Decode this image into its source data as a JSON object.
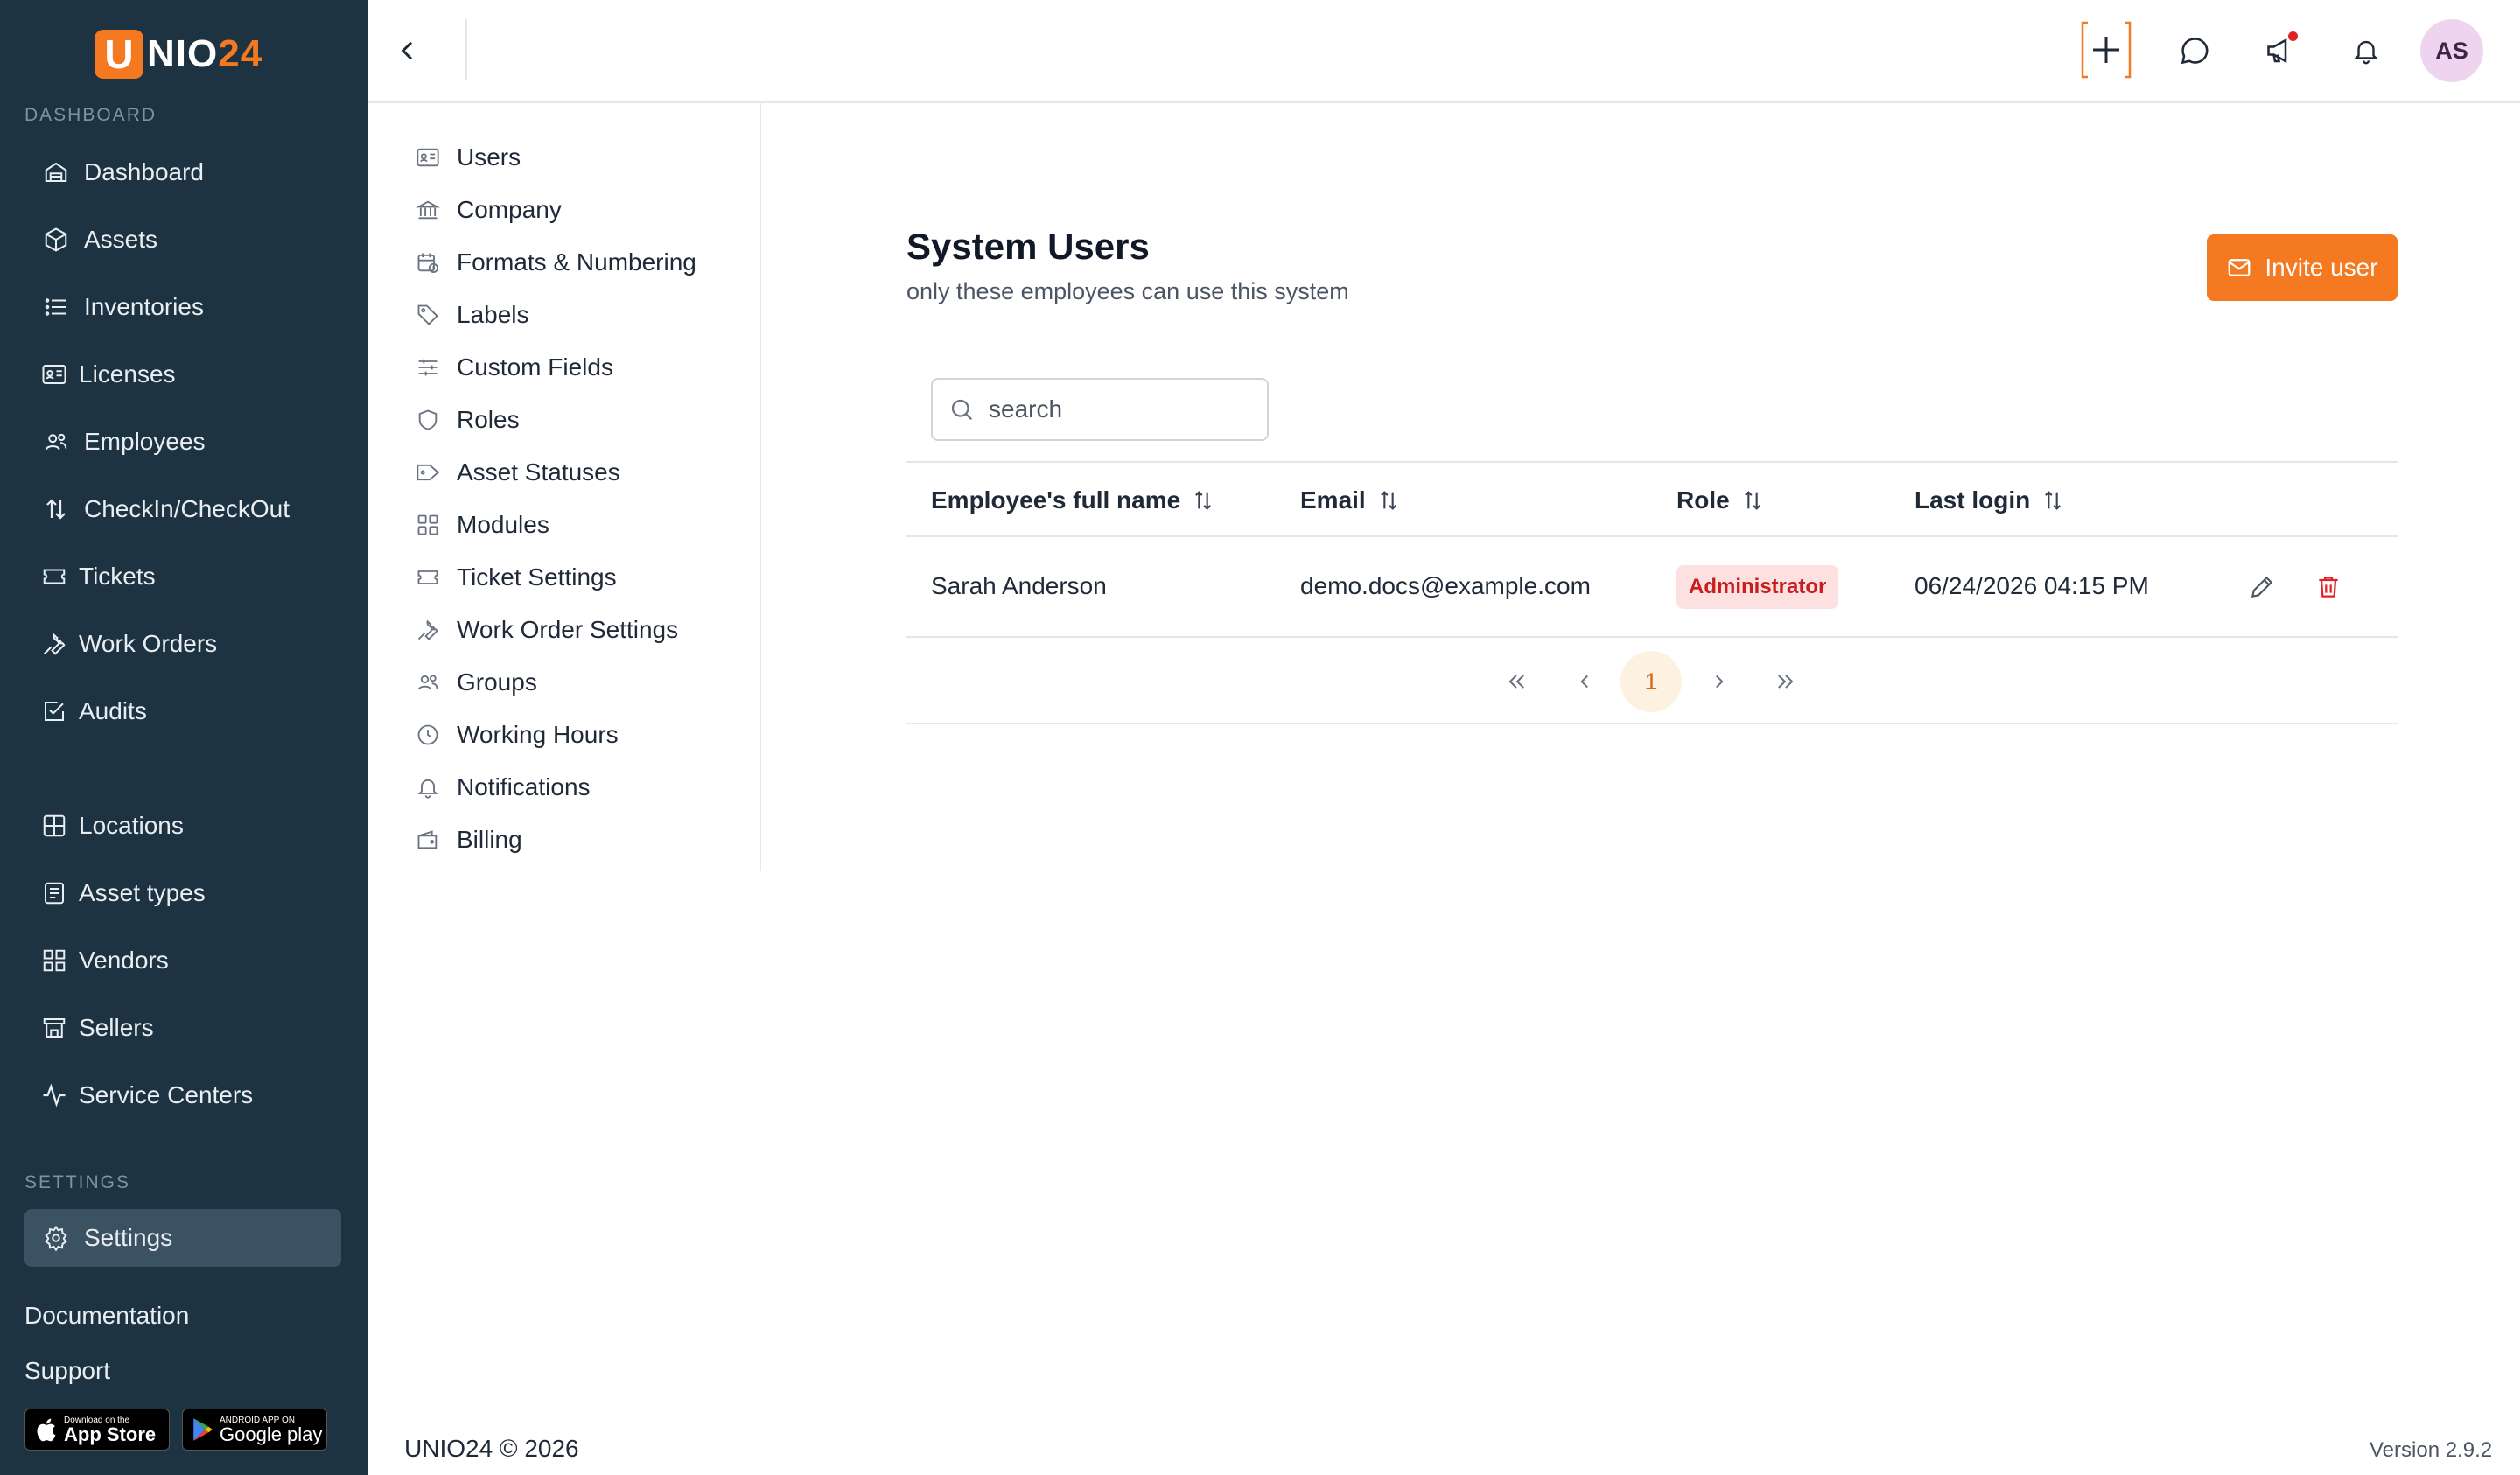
{
  "app": {
    "logo_letter": "U",
    "logo_rest": "NIO",
    "logo_num": "24"
  },
  "sidebar": {
    "dashboard_label": "DASHBOARD",
    "items": [
      {
        "label": "Dashboard",
        "icon": "dashboard-icon"
      },
      {
        "label": "Assets",
        "icon": "box-icon"
      },
      {
        "label": "Inventories",
        "icon": "list-icon"
      },
      {
        "label": "Licenses",
        "icon": "id-card-icon"
      },
      {
        "label": "Employees",
        "icon": "users-icon"
      },
      {
        "label": "CheckIn/CheckOut",
        "icon": "arrows-up-down-icon"
      },
      {
        "label": "Tickets",
        "icon": "ticket-icon"
      },
      {
        "label": "Work Orders",
        "icon": "wrench-icon"
      },
      {
        "label": "Audits",
        "icon": "checkbox-icon"
      },
      {
        "label": "Locations",
        "icon": "grid-icon"
      },
      {
        "label": "Asset types",
        "icon": "document-icon"
      },
      {
        "label": "Vendors",
        "icon": "apps-icon"
      },
      {
        "label": "Sellers",
        "icon": "store-icon"
      },
      {
        "label": "Service Centers",
        "icon": "activity-icon"
      }
    ],
    "settings_label": "SETTINGS",
    "settings_item": {
      "label": "Settings",
      "icon": "gear-icon"
    },
    "documentation": "Documentation",
    "support": "Support",
    "app_store": {
      "sub": "Download on the",
      "main": "App Store"
    },
    "google_play": {
      "sub": "ANDROID APP ON",
      "main": "Google play"
    }
  },
  "topbar": {
    "avatar_initials": "AS",
    "accent": "#f47920"
  },
  "settings_menu": [
    {
      "label": "Users",
      "icon": "user-card-icon"
    },
    {
      "label": "Company",
      "icon": "bank-icon"
    },
    {
      "label": "Formats & Numbering",
      "icon": "calendar-clock-icon"
    },
    {
      "label": "Labels",
      "icon": "tag-icon"
    },
    {
      "label": "Custom Fields",
      "icon": "sliders-icon"
    },
    {
      "label": "Roles",
      "icon": "shield-icon"
    },
    {
      "label": "Asset Statuses",
      "icon": "tag-icon"
    },
    {
      "label": "Modules",
      "icon": "grid-icon"
    },
    {
      "label": "Ticket Settings",
      "icon": "ticket-icon"
    },
    {
      "label": "Work Order Settings",
      "icon": "wrench-icon"
    },
    {
      "label": "Groups",
      "icon": "users-icon"
    },
    {
      "label": "Working Hours",
      "icon": "clock-icon"
    },
    {
      "label": "Notifications",
      "icon": "bell-icon"
    },
    {
      "label": "Billing",
      "icon": "wallet-icon"
    }
  ],
  "main": {
    "title": "System Users",
    "subtitle": "only these employees can use this system",
    "invite_label": "Invite user",
    "search_placeholder": "search",
    "columns": [
      "Employee's full name",
      "Email",
      "Role",
      "Last login"
    ],
    "rows": [
      {
        "name": "Sarah Anderson",
        "email": "demo.docs@example.com",
        "role": "Administrator",
        "last_login": "06/24/2026 04:15 PM"
      }
    ],
    "pagination": {
      "current_page": "1"
    }
  },
  "footer": {
    "copyright": "UNIO24 © 2026",
    "version": "Version 2.9.2"
  }
}
